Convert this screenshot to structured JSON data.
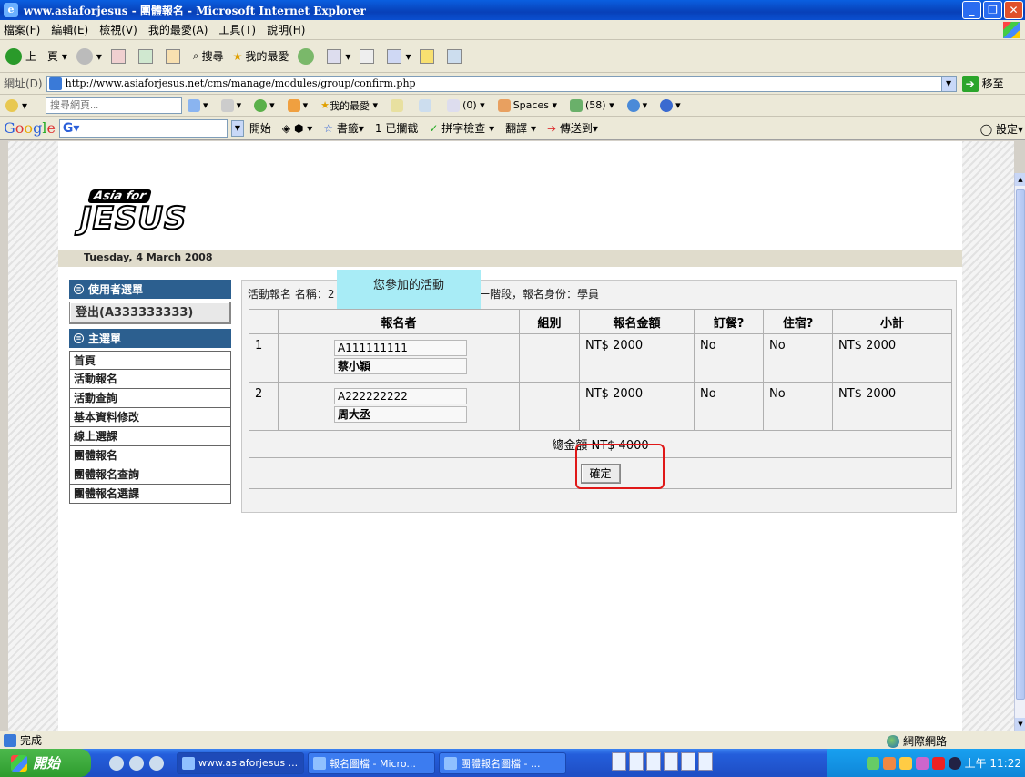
{
  "window": {
    "title": "www.asiaforjesus - 團體報名 - Microsoft Internet Explorer"
  },
  "menu": [
    "檔案(F)",
    "編輯(E)",
    "檢視(V)",
    "我的最愛(A)",
    "工具(T)",
    "說明(H)"
  ],
  "toolbar": {
    "back": "上一頁",
    "search": "搜尋",
    "favorites": "我的最愛"
  },
  "address": {
    "label": "網址(D)",
    "url": "http://www.asiaforjesus.net/cms/manage/modules/group/confirm.php",
    "go": "移至"
  },
  "searchbar": {
    "placeholder": "搜尋網頁...",
    "favorites": "我的最愛",
    "mail": "(0)",
    "spaces": "Spaces",
    "contacts": "(58)"
  },
  "googlebar": {
    "start": "開始",
    "bookmarks": "書籤",
    "blocked": "1 已攔截",
    "spellcheck": "拼字檢查",
    "translate": "翻譯",
    "sendto": "傳送到",
    "settings": "設定"
  },
  "site": {
    "logo_small": "Asia for",
    "logo_big": "JESUS",
    "date": "Tuesday, 4 March 2008"
  },
  "sidebar": {
    "user_header": "使用者選單",
    "logout": "登出(A333333333)",
    "main_header": "主選單",
    "items": [
      "首頁",
      "活動報名",
      "活動查詢",
      "基本資料修改",
      "線上選課",
      "團體報名",
      "團體報名查詢",
      "團體報名選課"
    ]
  },
  "main": {
    "info_prefix": "活動報名 名稱：2",
    "info_suffix": "第一階段，報名身份：學員",
    "tooltip": "您參加的活動",
    "columns": [
      "",
      "報名者",
      "組別",
      "報名金額",
      "訂餐?",
      "住宿?",
      "小計"
    ],
    "rows": [
      {
        "no": "1",
        "id": "A111111111",
        "name": "蔡小穎",
        "group": "",
        "amount": "NT$ 2000",
        "meal": "No",
        "lodging": "No",
        "subtotal": "NT$ 2000"
      },
      {
        "no": "2",
        "id": "A222222222",
        "name": "周大丞",
        "group": "",
        "amount": "NT$ 2000",
        "meal": "No",
        "lodging": "No",
        "subtotal": "NT$ 2000"
      }
    ],
    "total": "總金額 NT$ 4000",
    "confirm": "確定"
  },
  "status": {
    "text": "完成",
    "zone": "網際網路"
  },
  "taskbar": {
    "start": "開始",
    "tasks": [
      "www.asiaforjesus ...",
      "報名圖檔 - Micro...",
      "團體報名圖檔 - ..."
    ],
    "clock": "上午 11:22"
  }
}
